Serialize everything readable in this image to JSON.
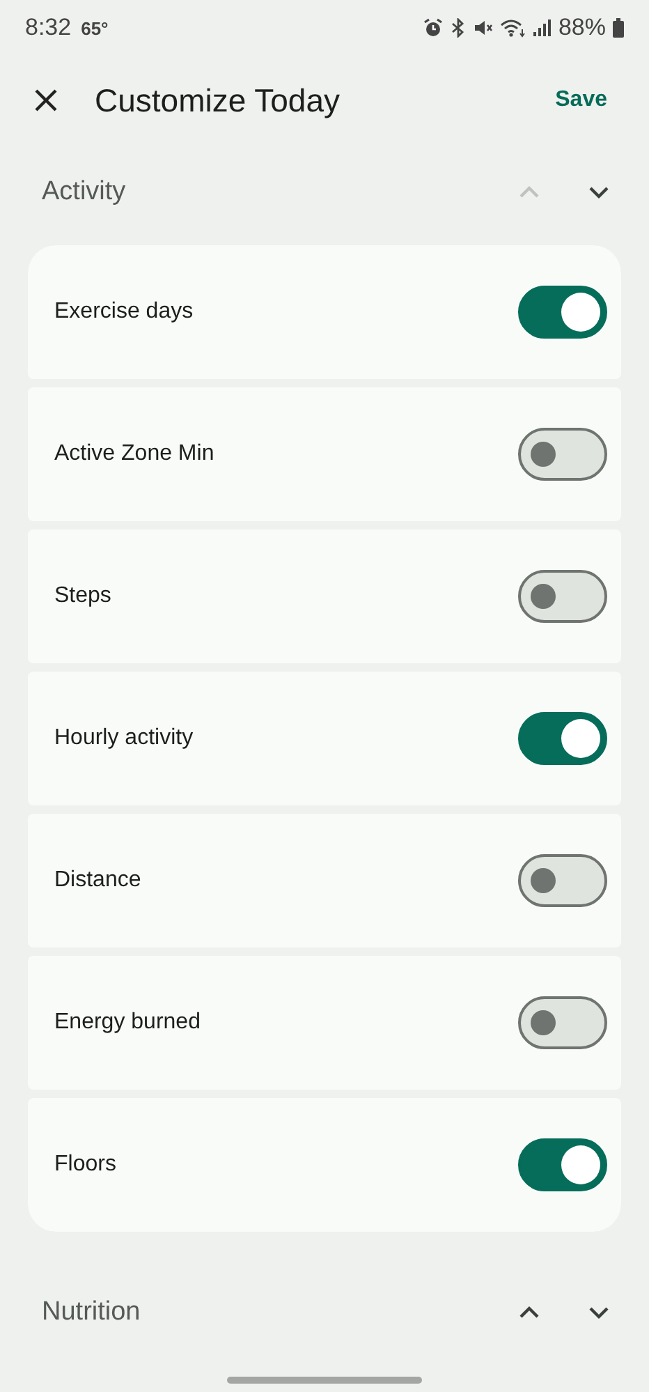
{
  "status_bar": {
    "time": "8:32",
    "temperature": "65°",
    "battery": "88%"
  },
  "header": {
    "title": "Customize Today",
    "save": "Save"
  },
  "sections": [
    {
      "title": "Activity",
      "move_up_disabled": true,
      "move_down_disabled": false,
      "items": [
        {
          "label": "Exercise days",
          "on": true
        },
        {
          "label": "Active Zone Min",
          "on": false
        },
        {
          "label": "Steps",
          "on": false
        },
        {
          "label": "Hourly activity",
          "on": true
        },
        {
          "label": "Distance",
          "on": false
        },
        {
          "label": "Energy burned",
          "on": false
        },
        {
          "label": "Floors",
          "on": true
        }
      ]
    },
    {
      "title": "Nutrition",
      "move_up_disabled": false,
      "move_down_disabled": false
    }
  ]
}
